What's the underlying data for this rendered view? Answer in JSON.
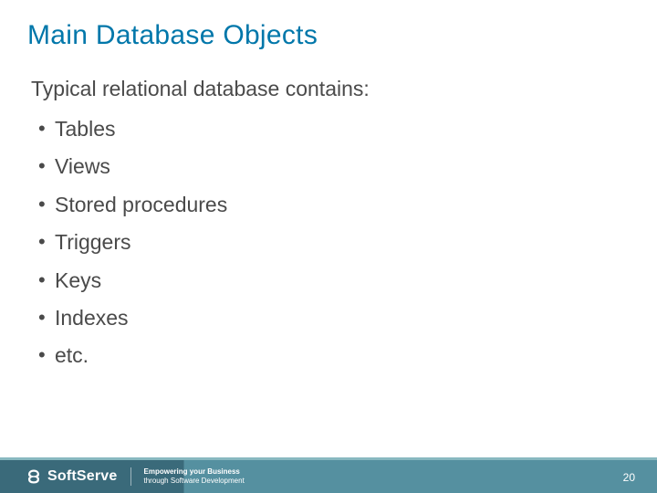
{
  "title": "Main Database Objects",
  "intro": "Typical relational database contains:",
  "bullets": [
    "Tables",
    "Views",
    "Stored procedures",
    "Triggers",
    "Keys",
    "Indexes",
    "etc."
  ],
  "footer": {
    "logo": "SoftServe",
    "tagline_bold": "Empowering your Business",
    "tagline_sub": "through Software Development",
    "page": "20"
  }
}
